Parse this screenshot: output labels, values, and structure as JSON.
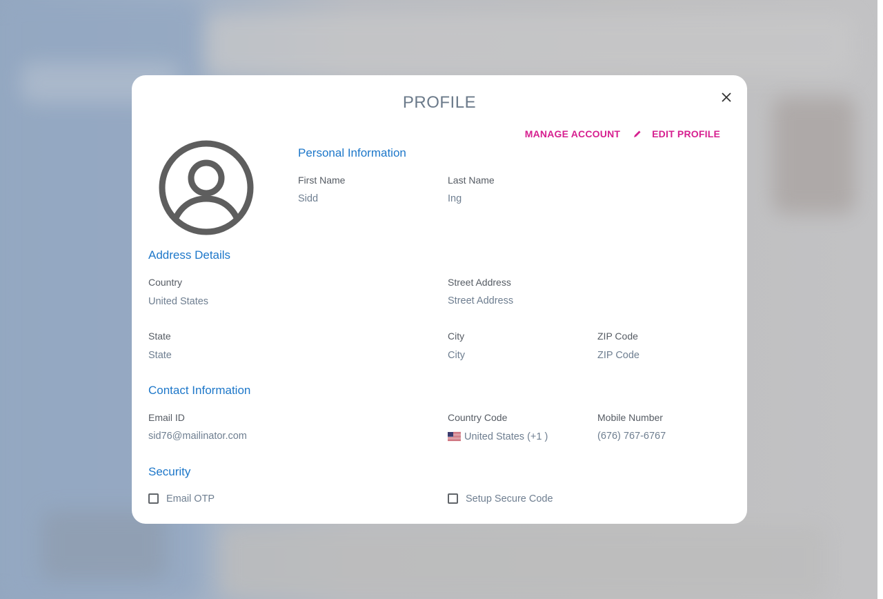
{
  "modal": {
    "title": "PROFILE",
    "close_icon": "close-icon",
    "actions": {
      "manage_account": "MANAGE ACCOUNT",
      "edit_profile": "EDIT PROFILE",
      "edit_icon": "pencil-icon"
    },
    "avatar_icon": "user-avatar-icon"
  },
  "personal": {
    "heading": "Personal Information",
    "first_name_label": "First Name",
    "first_name_value": "Sidd",
    "last_name_label": "Last Name",
    "last_name_value": "Ing"
  },
  "address": {
    "heading": "Address Details",
    "country_label": "Country",
    "country_value": "United States",
    "street_label": "Street Address",
    "street_value": "Street Address",
    "state_label": "State",
    "state_value": "State",
    "city_label": "City",
    "city_value": "City",
    "zip_label": "ZIP Code",
    "zip_value": "ZIP Code"
  },
  "contact": {
    "heading": "Contact Information",
    "email_label": "Email ID",
    "email_value": "sid76@mailinator.com",
    "country_code_label": "Country Code",
    "country_code_value": "United States (+1 )",
    "country_code_flag": "us-flag-icon",
    "mobile_label": "Mobile Number",
    "mobile_value": "(676) 767-6767"
  },
  "security": {
    "heading": "Security",
    "email_otp_label": "Email OTP",
    "email_otp_checked": false,
    "secure_code_label": "Setup Secure Code",
    "secure_code_checked": false
  },
  "colors": {
    "accent": "#d61f8f",
    "section": "#1d77c9",
    "value": "#6e7e90"
  }
}
